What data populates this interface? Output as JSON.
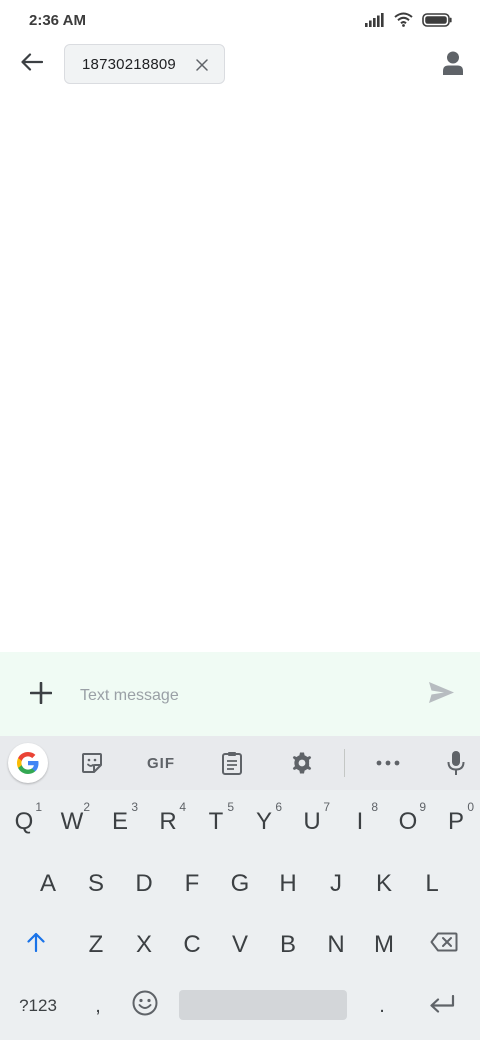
{
  "status_bar": {
    "time": "2:36 AM",
    "icons": [
      "signal-icon",
      "wifi-icon",
      "battery-icon"
    ]
  },
  "app_bar": {
    "back_icon": "arrow-back-icon",
    "recipient": "18730218809",
    "chip_remove_icon": "close-icon",
    "contact_icon": "person-icon"
  },
  "compose": {
    "attach_icon": "plus-icon",
    "value": "",
    "placeholder": "Text message",
    "send_icon": "send-icon"
  },
  "keyboard": {
    "toolbar": {
      "google": "google-g-icon",
      "sticker": "sticker-icon",
      "gif_label": "GIF",
      "clipboard": "clipboard-icon",
      "settings": "gear-icon",
      "more": "more-horizontal-icon",
      "mic": "microphone-icon"
    },
    "row1": [
      {
        "label": "Q",
        "hint": "1"
      },
      {
        "label": "W",
        "hint": "2"
      },
      {
        "label": "E",
        "hint": "3"
      },
      {
        "label": "R",
        "hint": "4"
      },
      {
        "label": "T",
        "hint": "5"
      },
      {
        "label": "Y",
        "hint": "6"
      },
      {
        "label": "U",
        "hint": "7"
      },
      {
        "label": "I",
        "hint": "8"
      },
      {
        "label": "O",
        "hint": "9"
      },
      {
        "label": "P",
        "hint": "0"
      }
    ],
    "row2": [
      "A",
      "S",
      "D",
      "F",
      "G",
      "H",
      "J",
      "K",
      "L"
    ],
    "row3": [
      "Z",
      "X",
      "C",
      "V",
      "B",
      "N",
      "M"
    ],
    "row4": {
      "symbols": "?123",
      "comma": ",",
      "emoji_icon": "emoji-icon",
      "period": ".",
      "enter_icon": "enter-icon"
    },
    "shift_icon": "shift-icon",
    "backspace_icon": "backspace-icon",
    "accent_color": "#1a73e8"
  }
}
